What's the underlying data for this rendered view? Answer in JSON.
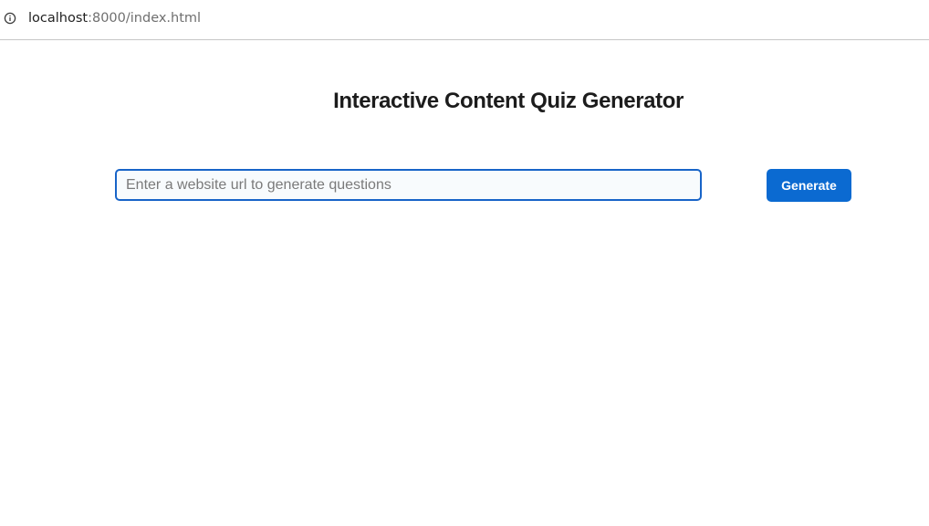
{
  "browser": {
    "url_host": "localhost",
    "url_path": ":8000/index.html",
    "info_icon": "info-icon"
  },
  "page": {
    "title": "Interactive Content Quiz Generator"
  },
  "form": {
    "url_placeholder": "Enter a website url to generate questions",
    "url_value": "",
    "generate_label": "Generate"
  },
  "colors": {
    "accent": "#0b6ad1",
    "input_border": "#1864c8",
    "title": "#1c1c1c"
  }
}
